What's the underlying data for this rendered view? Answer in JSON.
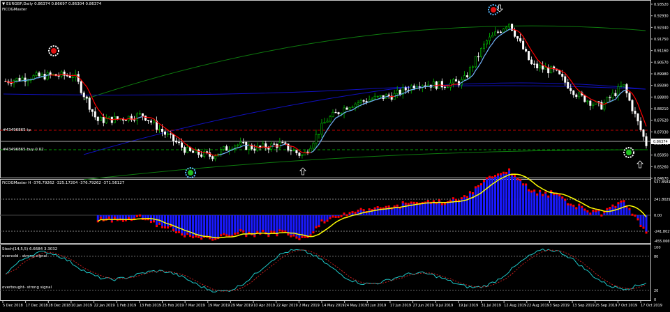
{
  "header": {
    "symbol_line": "▼ EURGBP,Daily  0.86374 0.86697 0.86304 0.86374",
    "indicator_name": "FiCOGMaster"
  },
  "main_panel": {
    "price_labels": [
      "0.93520",
      "0.92930",
      "0.92340",
      "0.91750",
      "0.91160",
      "0.90570",
      "0.89980",
      "0.89390",
      "0.88800",
      "0.88210",
      "0.87620",
      "0.87030",
      "0.86440",
      "0.85850",
      "0.85260",
      "0.84670"
    ],
    "current_price": "0.86374",
    "level_tp_label": "#43496865 tp",
    "level_buy_label": "#43496865 buy 0.02"
  },
  "osc_panel": {
    "title": "FiCOGMaster H -376.79262 -325.17204 -376.79262 -371.56127",
    "labels": [
      "537.85818",
      "241.80299",
      "0.00",
      "-241.80299",
      "-455.06699"
    ]
  },
  "stoch_panel": {
    "title": "Stoch(14,5,5) 6.6684 3.3032",
    "oversold_label": "oversold - strong signal",
    "overbought_label": "overbought- strong signal",
    "labels": [
      "100",
      "80",
      "20",
      "0"
    ]
  },
  "date_axis": [
    "5 Dec 2018",
    "17 Dec 2018",
    "28 Dec 2018",
    "10 Jan 2019",
    "22 Jan 2019",
    "1 Feb 2019",
    "13 Feb 2019",
    "25 Feb 2019",
    "7 Mar 2019",
    "19 Mar 2019",
    "29 Mar 2019",
    "10 Apr 2019",
    "22 Apr 2019",
    "2 May 2019",
    "14 May 2019",
    "24 May 2019",
    "5 Jun 2019",
    "17 Jun 2019",
    "27 Jun 2019",
    "9 Jul 2019",
    "19 Jul 2019",
    "31 Jul 2019",
    "12 Aug 2019",
    "22 Aug 2019",
    "3 Sep 2019",
    "13 Sep 2019",
    "25 Sep 2019",
    "7 Oct 2019",
    "17 Oct 2019"
  ],
  "colors": {
    "bull_candle": "#00c000",
    "bear_candle": "#ffffff",
    "ma_red": "#ff0000",
    "ma_skyblue": "#56b8ff",
    "regression_green": "#0e7a0e",
    "regression_blue": "#1010c0",
    "osc_blue": "#1a1aff",
    "osc_red": "#ff0000",
    "osc_signal": "#ffff00",
    "stoch_main": "#1ec8c8",
    "stoch_signal": "#c81e1e"
  },
  "icons": [
    "sell-signal-icon",
    "buy-signal-icon",
    "up-arrow-icon",
    "down-arrow-icon"
  ],
  "chart_data": {
    "type": "candlestick",
    "symbol": "EURGBP",
    "timeframe": "Daily",
    "ohlc_last": {
      "open": 0.86374,
      "high": 0.86697,
      "low": 0.86304,
      "close": 0.86374
    },
    "price_range": [
      0.8467,
      0.9352
    ],
    "x": [
      "2018-12-05",
      "2018-12-17",
      "2018-12-28",
      "2019-01-10",
      "2019-01-22",
      "2019-02-01",
      "2019-02-13",
      "2019-02-25",
      "2019-03-07",
      "2019-03-19",
      "2019-03-29",
      "2019-04-10",
      "2019-04-22",
      "2019-05-02",
      "2019-05-14",
      "2019-05-24",
      "2019-06-05",
      "2019-06-17",
      "2019-06-27",
      "2019-07-09",
      "2019-07-19",
      "2019-07-31",
      "2019-08-12",
      "2019-08-22",
      "2019-09-03",
      "2019-09-13",
      "2019-09-25",
      "2019-10-07",
      "2019-10-17"
    ],
    "close_approx": [
      0.896,
      0.898,
      0.899,
      0.899,
      0.876,
      0.877,
      0.879,
      0.869,
      0.86,
      0.858,
      0.864,
      0.862,
      0.864,
      0.858,
      0.876,
      0.884,
      0.887,
      0.889,
      0.895,
      0.894,
      0.896,
      0.916,
      0.926,
      0.904,
      0.901,
      0.889,
      0.883,
      0.894,
      0.864
    ],
    "oscillator_range": [
      -455.06699,
      537.85818
    ],
    "stoch_range": [
      0,
      100
    ]
  }
}
